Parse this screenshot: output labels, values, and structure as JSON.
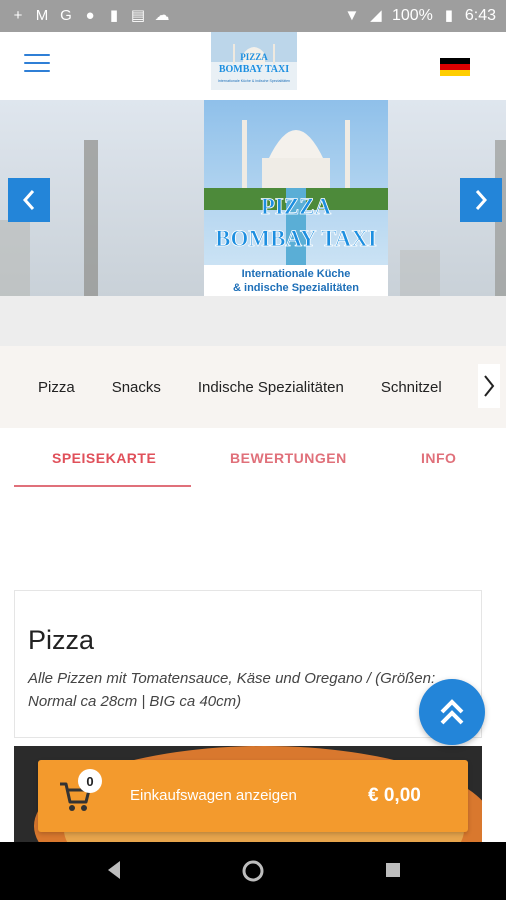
{
  "status_bar": {
    "battery_percent": "100%",
    "time": "6:43"
  },
  "header": {
    "logo_line1": "PIZZA",
    "logo_line2": "BOMBAY TAXI",
    "logo_tagline": "Internationale Küche & indische Spezialitäten",
    "flag_colors": [
      "#000000",
      "#dd0000",
      "#ffce00"
    ]
  },
  "banner": {
    "title_line1": "PIZZA",
    "title_line2": "BOMBAY TAXI",
    "subtitle_line1": "Internationale Küche",
    "subtitle_line2": "& indische Spezialitäten",
    "prev_icon": "chevron-left-icon",
    "next_icon": "chevron-right-icon"
  },
  "categories": {
    "items": [
      "Pizza",
      "Snacks",
      "Indische Spezialitäten",
      "Schnitzel"
    ],
    "next_icon": "chevron-right-icon"
  },
  "tabs": {
    "menu": "SPEISEKARTE",
    "reviews": "BEWERTUNGEN",
    "info": "INFO"
  },
  "section": {
    "title": "Pizza",
    "description": "Alle Pizzen mit Tomatensauce, Käse und Oregano / (Größen: Normal ca 28cm | BIG ca 40cm)"
  },
  "cart": {
    "count": "0",
    "label": "Einkaufswagen anzeigen",
    "price": "€ 0,00"
  },
  "colors": {
    "accent_blue": "#2385d9",
    "tab_red": "#e0707a",
    "cart_orange": "#f39a2d"
  }
}
